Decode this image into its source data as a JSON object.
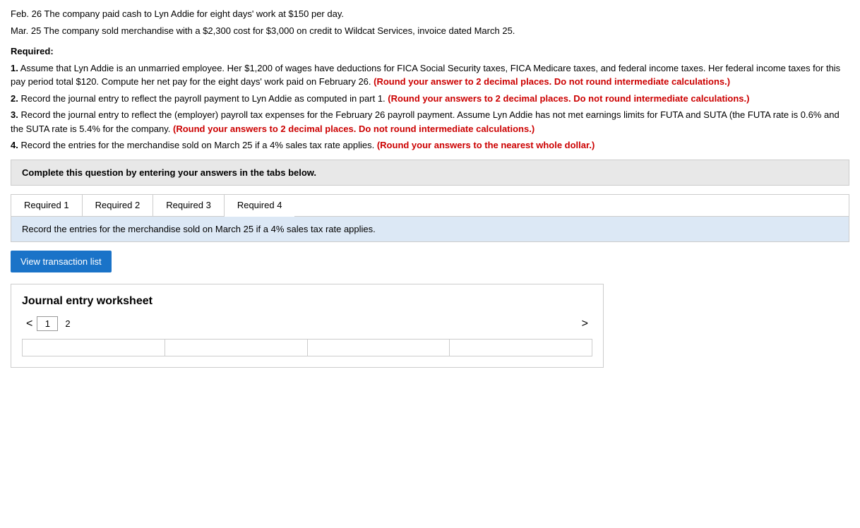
{
  "transactions": {
    "line1": "Feb. 26 The company paid cash to Lyn Addie for eight days' work at $150 per day.",
    "line2": "Mar. 25 The company sold merchandise with a $2,300 cost for $3,000 on credit to Wildcat Services, invoice dated March 25."
  },
  "required_label": "Required:",
  "items": [
    {
      "number": "1.",
      "text_before": "Assume that Lyn Addie is an unmarried employee. Her $1,200 of wages have deductions for FICA Social Security taxes, FICA Medicare taxes, and federal income taxes. Her federal income taxes for this pay period total $120. Compute her net pay for the eight days' work paid on February 26.",
      "text_bold_red": "(Round your answer to 2 decimal places. Do not round intermediate calculations.)"
    },
    {
      "number": "2.",
      "text_before": "Record the journal entry to reflect the payroll payment to Lyn Addie as computed in part 1.",
      "text_bold_red": "(Round your answers to 2 decimal places. Do not round intermediate calculations.)"
    },
    {
      "number": "3.",
      "text_before": "Record the journal entry to reflect the (employer) payroll tax expenses for the February 26 payroll payment. Assume Lyn Addie has not met earnings limits for FUTA and SUTA (the FUTA rate is 0.6% and the SUTA rate is 5.4% for the company.",
      "text_bold_red": "(Round your answers to 2 decimal places. Do not round intermediate calculations.)"
    },
    {
      "number": "4.",
      "text_before": "Record the entries for the merchandise sold on March 25 if a 4% sales tax rate applies.",
      "text_bold_red": "(Round your answers to the nearest whole dollar.)"
    }
  ],
  "instruction_box": {
    "text": "Complete this question by entering your answers in the tabs below."
  },
  "tabs": [
    {
      "label": "Required 1",
      "active": false
    },
    {
      "label": "Required 2",
      "active": false
    },
    {
      "label": "Required 3",
      "active": false
    },
    {
      "label": "Required 4",
      "active": true
    }
  ],
  "tab_content": "Record the entries for the merchandise sold on March 25 if a 4% sales tax rate applies.",
  "btn_label": "View transaction list",
  "worksheet": {
    "title": "Journal entry worksheet",
    "page_current": "1",
    "page_next": "2",
    "nav_left": "<",
    "nav_right": ">"
  }
}
